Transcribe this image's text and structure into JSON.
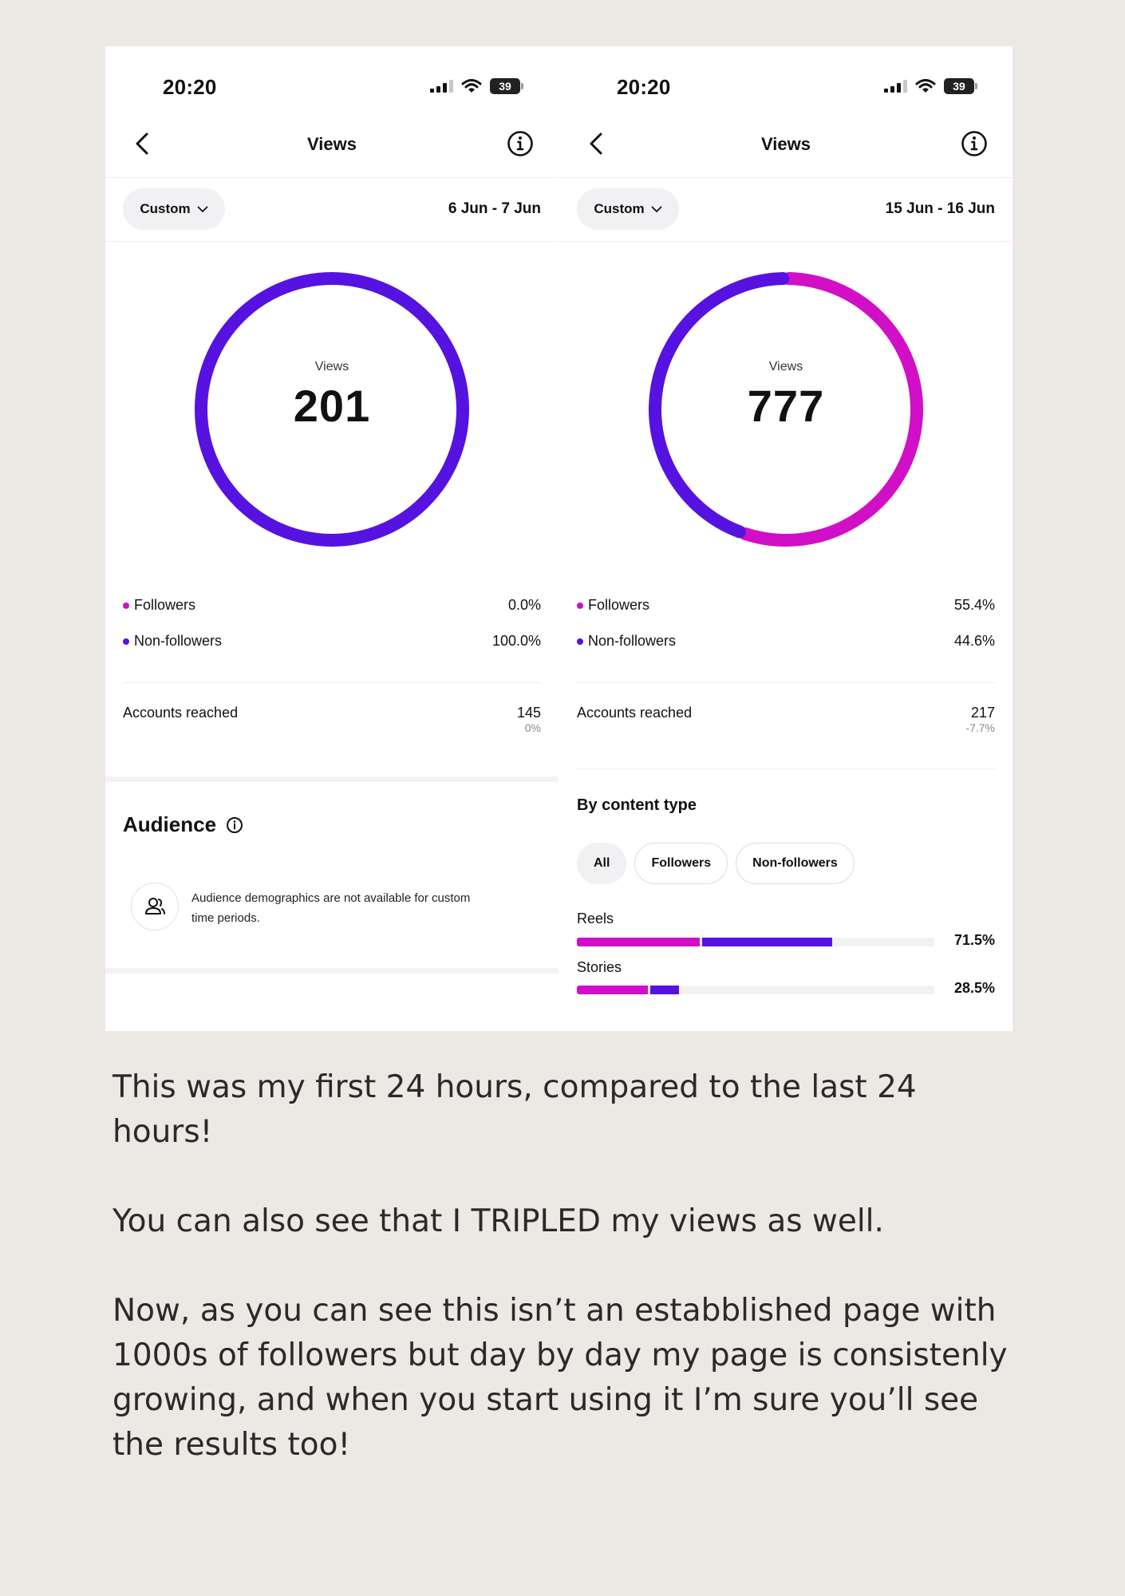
{
  "colors": {
    "followers": "#d10fc6",
    "non_followers": "#5512e0",
    "background": "#ece8e4"
  },
  "left": {
    "status_time": "20:20",
    "battery": "39",
    "title": "Views",
    "filter_label": "Custom",
    "date_range": "6 Jun - 7 Jun",
    "views_label": "Views",
    "views_value": "201",
    "followers_label": "Followers",
    "followers_pct": "0.0%",
    "non_followers_label": "Non-followers",
    "non_followers_pct": "100.0%",
    "reach_label": "Accounts reached",
    "reach_value": "145",
    "reach_change": "0%",
    "audience_title": "Audience",
    "audience_message": "Audience demographics are not available for custom time periods."
  },
  "right": {
    "status_time": "20:20",
    "battery": "39",
    "title": "Views",
    "filter_label": "Custom",
    "date_range": "15 Jun - 16 Jun",
    "views_label": "Views",
    "views_value": "777",
    "followers_label": "Followers",
    "followers_pct": "55.4%",
    "non_followers_label": "Non-followers",
    "non_followers_pct": "44.6%",
    "reach_label": "Accounts reached",
    "reach_value": "217",
    "reach_change": "-7.7%",
    "content_type_title": "By content type",
    "chips": [
      "All",
      "Followers",
      "Non-followers"
    ],
    "content_rows": [
      {
        "label": "Reels",
        "pct": "71.5%",
        "followers_share": 0.35,
        "non_followers_share": 0.365
      },
      {
        "label": "Stories",
        "pct": "28.5%",
        "followers_share": 0.205,
        "non_followers_share": 0.08
      }
    ]
  },
  "chart_data": [
    {
      "type": "pie",
      "title": "Views",
      "total": 201,
      "categories": [
        "Followers",
        "Non-followers"
      ],
      "values": [
        0.0,
        100.0
      ]
    },
    {
      "type": "pie",
      "title": "Views",
      "total": 777,
      "categories": [
        "Followers",
        "Non-followers"
      ],
      "values": [
        55.4,
        44.6
      ]
    }
  ],
  "caption": {
    "p1": "This was my first 24 hours, compared to the last 24 hours!",
    "p2": "You can also see that I TRIPLED my views as well.",
    "p3": "Now, as you can see this isn’t an estabblished page with 1000s of followers  but day by day my page is consistenly growing, and when you start using it I’m sure you’ll see the results too!"
  }
}
